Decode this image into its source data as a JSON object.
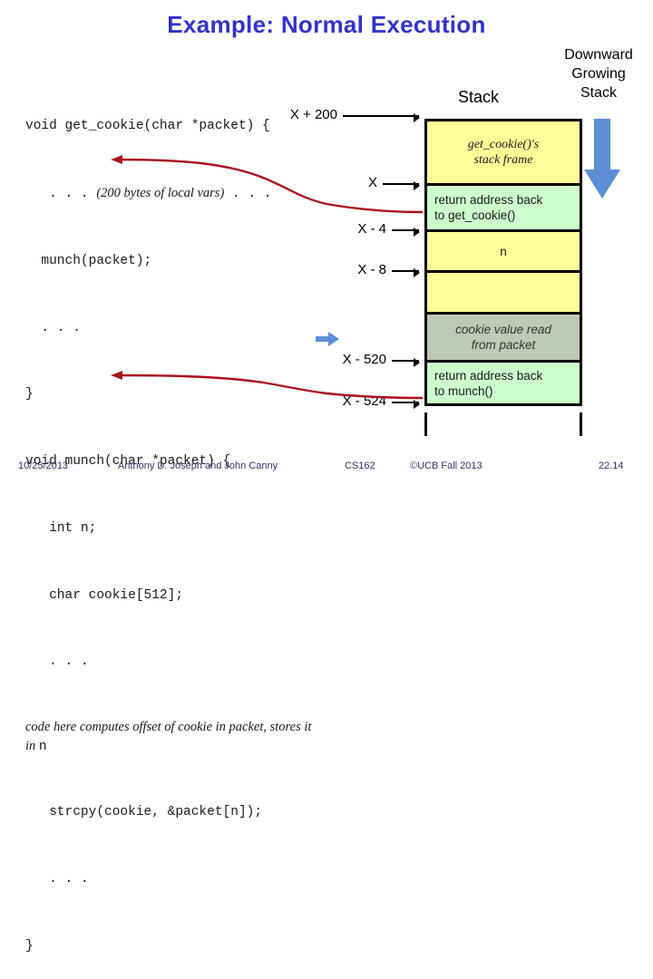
{
  "slide": {
    "title": "Example: Normal Execution"
  },
  "code": {
    "lines": [
      {
        "type": "mono",
        "text": "void get_cookie(char *packet) {"
      },
      {
        "type": "mixed",
        "pre": "   . . . ",
        "italic": "(200 bytes of local vars)",
        "post": " . . ."
      },
      {
        "type": "mono",
        "text": "  munch(packet);"
      },
      {
        "type": "mono",
        "text": "  . . ."
      },
      {
        "type": "mono",
        "text": "}"
      },
      {
        "type": "mono",
        "text": "void munch(char *packet) {"
      },
      {
        "type": "mono",
        "text": "   int n;"
      },
      {
        "type": "mono",
        "text": "   char cookie[512];"
      },
      {
        "type": "mono",
        "text": "   . . ."
      },
      {
        "type": "italic-block",
        "italic": "code here computes offset of cookie in packet, stores it in ",
        "mono_tail": "n"
      },
      {
        "type": "mono",
        "text": "   strcpy(cookie, &packet[n]);"
      },
      {
        "type": "mono",
        "text": "   . . ."
      },
      {
        "type": "mono",
        "text": "}"
      }
    ]
  },
  "stack": {
    "heading": "Stack",
    "direction_label": "Downward\nGrowing\nStack",
    "direction_lines": [
      "Downward",
      "Growing",
      "Stack"
    ],
    "addresses": [
      {
        "label": "X + 200"
      },
      {
        "label": "X"
      },
      {
        "label": "X - 4"
      },
      {
        "label": "X - 8"
      },
      {
        "label": "X - 520"
      },
      {
        "label": "X - 524"
      }
    ],
    "cells": [
      {
        "id": "get-cookie-frame",
        "text": "get_cookie()'s\nstack frame",
        "lines": [
          "get_cookie()'s",
          "stack frame"
        ],
        "fill": "#ffff99",
        "style": "serif-italic"
      },
      {
        "id": "return-addr-get-cookie",
        "text": "return address back to get_cookie()",
        "lines": [
          "return address back",
          "to get_cookie()"
        ],
        "fill": "#ccffcc",
        "style": "plain-left"
      },
      {
        "id": "n-slot",
        "text": "n",
        "lines": [
          "n"
        ],
        "fill": "#ffff99",
        "style": "plain-center"
      },
      {
        "id": "cookie-buffer-empty",
        "text": "",
        "lines": [],
        "fill": "#ffff99",
        "style": "plain-center"
      },
      {
        "id": "cookie-value",
        "text": "cookie value read from packet",
        "lines": [
          "cookie value read",
          "from packet"
        ],
        "fill": "#bfc9b8",
        "style": "sans-italic"
      },
      {
        "id": "return-addr-munch",
        "text": "return address back to munch()",
        "lines": [
          "return address back",
          "to munch()"
        ],
        "fill": "#ccffcc",
        "style": "plain-left"
      }
    ]
  },
  "colors": {
    "title": "#3333cc",
    "stack_yellow": "#ffff99",
    "stack_green": "#ccffcc",
    "cookie_gray": "#bfc9b8",
    "arrow_blue": "#5b8fd6",
    "callout_red": "#aa1122",
    "footer_text": "#333366"
  },
  "footer": {
    "date": "10/25/2013",
    "authors": "Anthony D. Joseph and John Canny",
    "course": "CS162",
    "copyright": "©UCB Fall 2013",
    "page": "22.14"
  }
}
